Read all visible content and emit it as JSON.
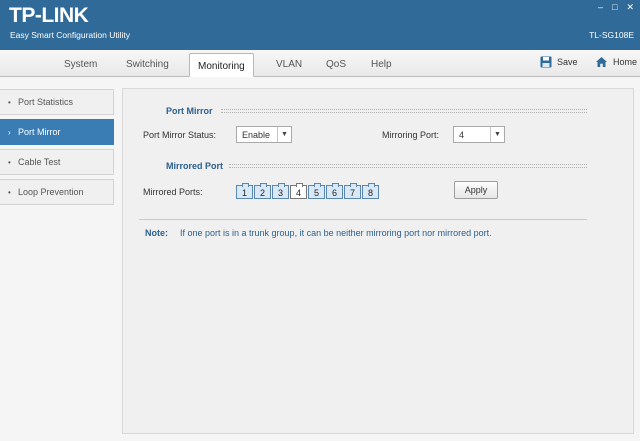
{
  "header": {
    "brand": "TP-LINK",
    "subtitle": "Easy Smart Configuration Utility",
    "model": "TL-SG108E",
    "minimize": "–",
    "maximize": "□",
    "close": "✕"
  },
  "tabs": [
    {
      "label": "System"
    },
    {
      "label": "Switching"
    },
    {
      "label": "Monitoring"
    },
    {
      "label": "VLAN"
    },
    {
      "label": "QoS"
    },
    {
      "label": "Help"
    }
  ],
  "active_tab": "Monitoring",
  "toolbar": {
    "save_label": "Save",
    "home_label": "Home"
  },
  "sidebar": {
    "items": [
      {
        "label": "Port Statistics",
        "marker": "•"
      },
      {
        "label": "Port Mirror",
        "marker": "›"
      },
      {
        "label": "Cable Test",
        "marker": "•"
      },
      {
        "label": "Loop Prevention",
        "marker": "•"
      }
    ],
    "active": "Port Mirror"
  },
  "port_mirror": {
    "section_title": "Port Mirror",
    "status_label": "Port Mirror Status:",
    "status_value": "Enable",
    "mirroring_port_label": "Mirroring Port:",
    "mirroring_port_value": "4"
  },
  "mirrored_port": {
    "section_title": "Mirrored Port",
    "ports_label": "Mirrored Ports:",
    "ports": [
      "1",
      "2",
      "3",
      "4",
      "5",
      "6",
      "7",
      "8"
    ],
    "selected_port": "4",
    "apply_label": "Apply"
  },
  "note": {
    "label": "Note:",
    "text": "If one port is in a trunk group, it can be neither mirroring port nor mirrored port."
  },
  "colors": {
    "header_bg": "#2f6a98",
    "accent": "#3a7db4",
    "section_title": "#2a5f8f"
  },
  "icons": {
    "save": "floppy-disk-icon",
    "home": "house-icon"
  }
}
